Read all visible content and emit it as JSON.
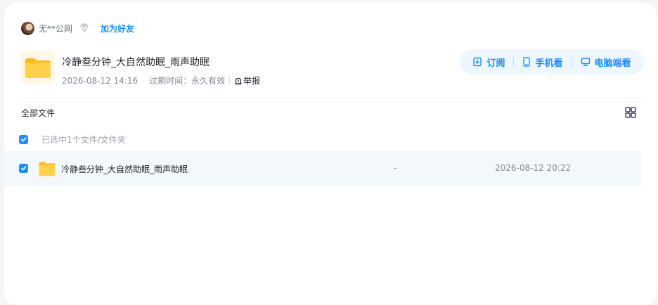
{
  "user": {
    "name": "无**公网",
    "add_friend_label": "加为好友"
  },
  "share": {
    "title": "冷静叁分钟_大自然助眠_雨声助眠",
    "created": "2026-08-12 14:16",
    "expiry_label": "过期时间：",
    "expiry_value": "永久有效",
    "report_label": "举报"
  },
  "actions": {
    "subscribe": "订阅",
    "mobile": "手机看",
    "desktop": "电脑端看"
  },
  "file_list": {
    "breadcrumb": "全部文件",
    "selection_text": "已选中1个文件/文件夹",
    "rows": [
      {
        "name": "冷静叁分钟_大自然助眠_雨声助眠",
        "size": "-",
        "date": "2026-08-12 20:22"
      }
    ]
  },
  "colors": {
    "accent": "#1e8dff",
    "folder": "#ffc53d",
    "row_highlight": "#f3f8fd"
  }
}
